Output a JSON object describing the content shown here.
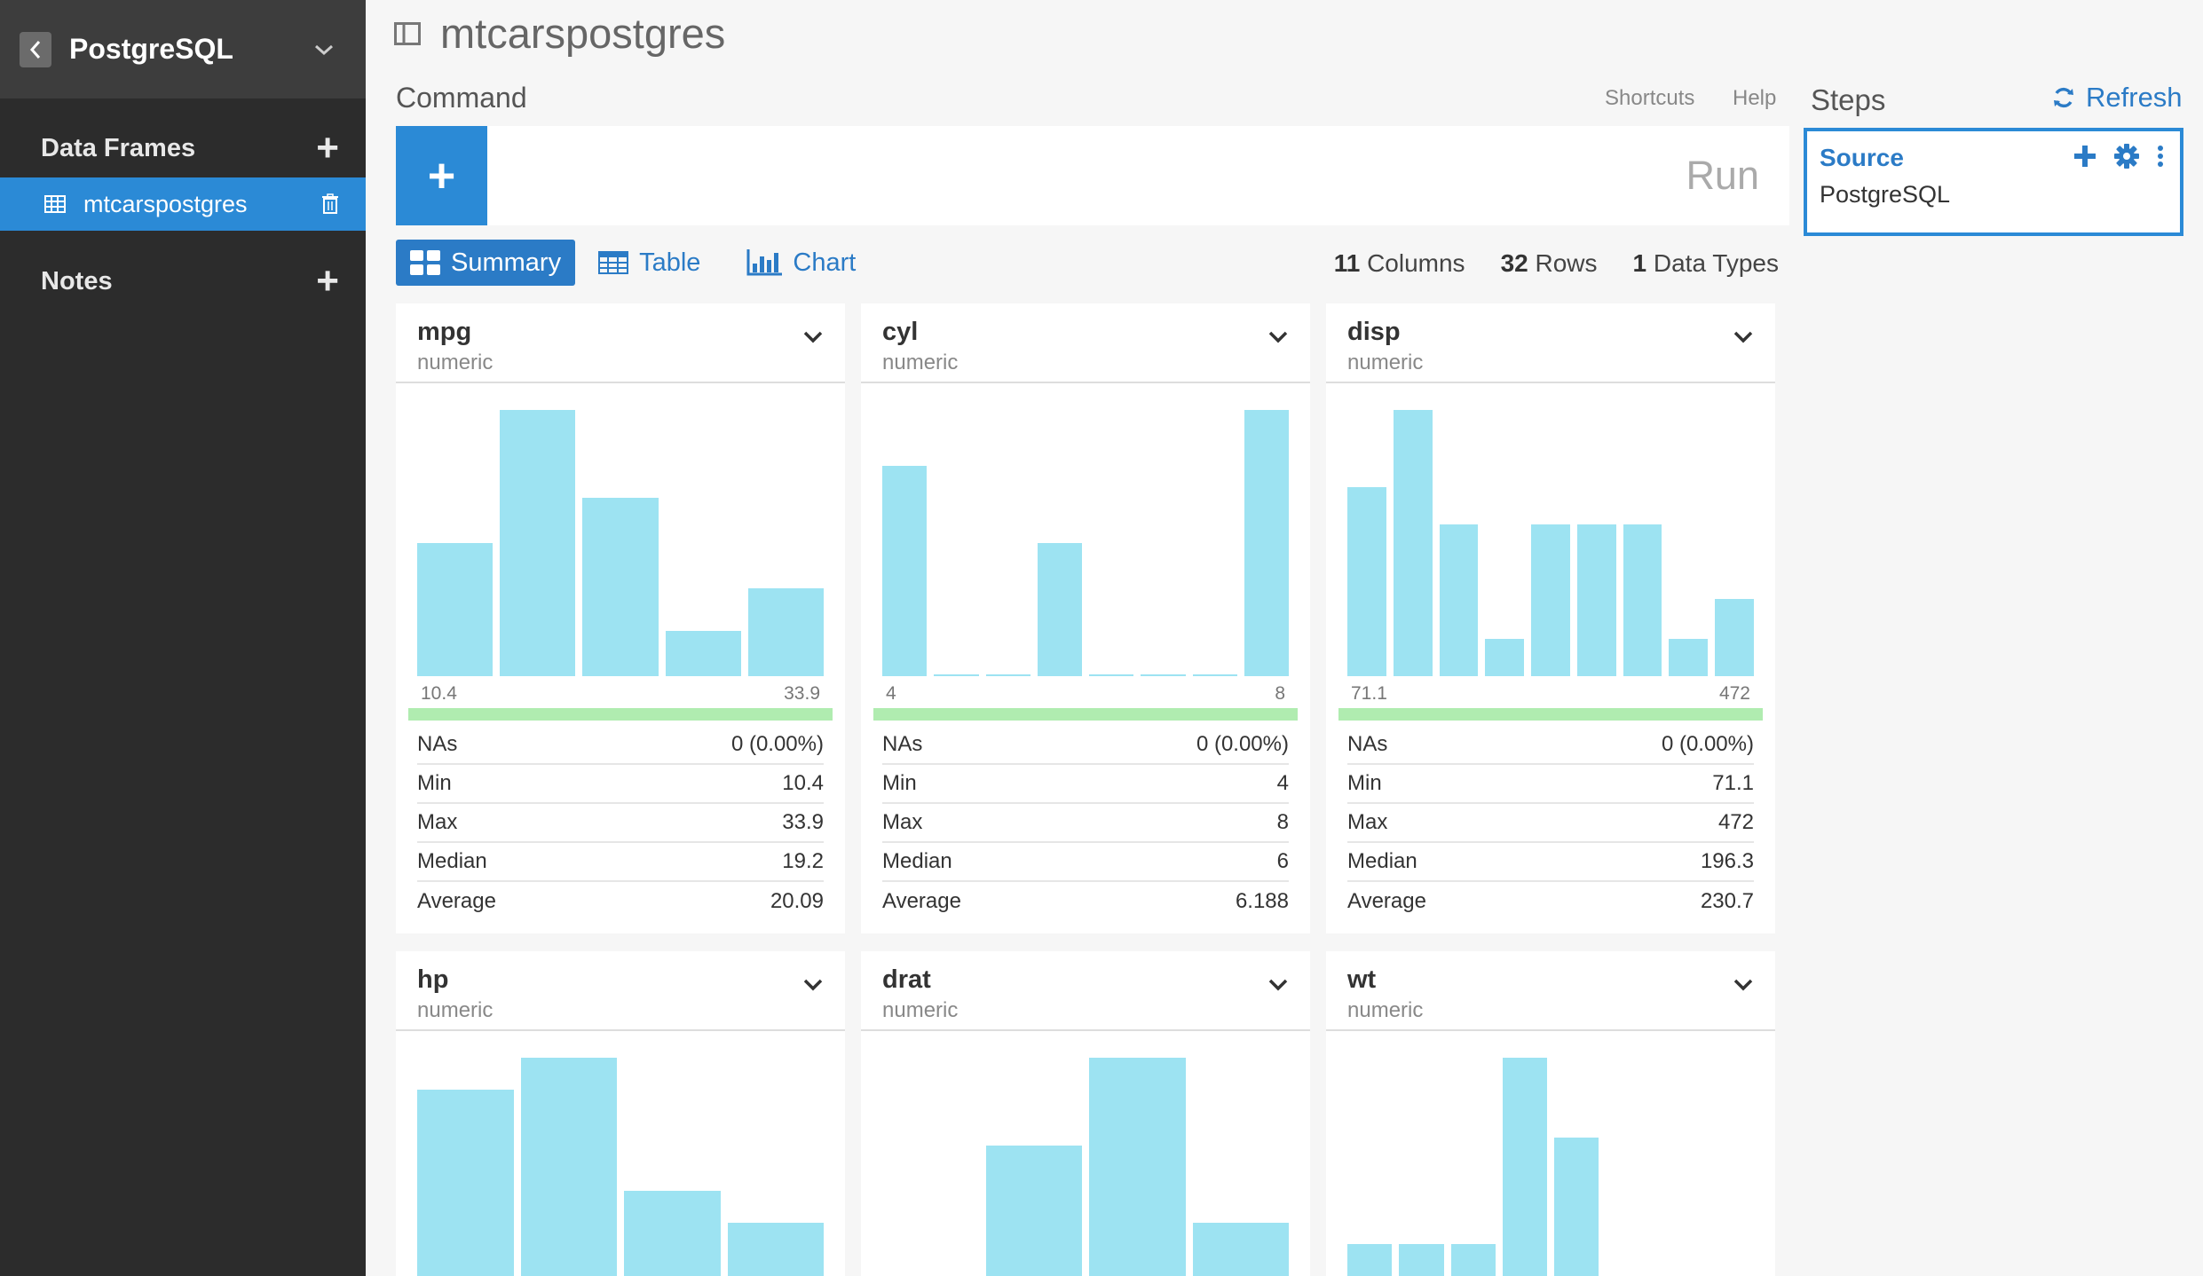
{
  "sidebar": {
    "title": "PostgreSQL",
    "sections": {
      "data_frames": "Data Frames",
      "notes": "Notes"
    },
    "active_frame": "mtcarspostgres"
  },
  "main": {
    "page_title": "mtcarspostgres",
    "command_label": "Command",
    "shortcuts": "Shortcuts",
    "help": "Help",
    "run": "Run",
    "add_symbol": "+",
    "tabs": [
      {
        "label": "Summary",
        "active": true
      },
      {
        "label": "Table",
        "active": false
      },
      {
        "label": "Chart",
        "active": false
      }
    ],
    "stats": {
      "columns_count": "11",
      "columns_label": "Columns",
      "rows_count": "32",
      "rows_label": "Rows",
      "types_count": "1",
      "types_label": "Data Types"
    }
  },
  "cards": [
    {
      "name": "mpg",
      "type": "numeric",
      "hist": [
        0.5,
        1.0,
        0.67,
        0.17,
        0.33
      ],
      "min_label": "10.4",
      "max_label": "33.9",
      "stats": [
        {
          "label": "NAs",
          "value": "0 (0.00%)"
        },
        {
          "label": "Min",
          "value": "10.4"
        },
        {
          "label": "Max",
          "value": "33.9"
        },
        {
          "label": "Median",
          "value": "19.2"
        },
        {
          "label": "Average",
          "value": "20.09"
        }
      ]
    },
    {
      "name": "cyl",
      "type": "numeric",
      "hist": [
        0.79,
        0.0,
        0.0,
        0.5,
        0.0,
        0.0,
        0.0,
        1.0
      ],
      "min_label": "4",
      "max_label": "8",
      "stats": [
        {
          "label": "NAs",
          "value": "0 (0.00%)"
        },
        {
          "label": "Min",
          "value": "4"
        },
        {
          "label": "Max",
          "value": "8"
        },
        {
          "label": "Median",
          "value": "6"
        },
        {
          "label": "Average",
          "value": "6.188"
        }
      ]
    },
    {
      "name": "disp",
      "type": "numeric",
      "hist": [
        0.71,
        1.0,
        0.57,
        0.14,
        0.57,
        0.57,
        0.57,
        0.14,
        0.29
      ],
      "min_label": "71.1",
      "max_label": "472",
      "stats": [
        {
          "label": "NAs",
          "value": "0 (0.00%)"
        },
        {
          "label": "Min",
          "value": "71.1"
        },
        {
          "label": "Max",
          "value": "472"
        },
        {
          "label": "Median",
          "value": "196.3"
        },
        {
          "label": "Average",
          "value": "230.7"
        }
      ]
    },
    {
      "name": "hp",
      "type": "numeric",
      "hist": [
        0.88,
        1.0,
        0.5,
        0.38
      ],
      "min_label": "",
      "max_label": "",
      "stats": []
    },
    {
      "name": "drat",
      "type": "numeric",
      "hist": [
        0.17,
        0.67,
        1.0,
        0.38
      ],
      "min_label": "",
      "max_label": "",
      "stats": []
    },
    {
      "name": "wt",
      "type": "numeric",
      "hist": [
        0.3,
        0.3,
        0.3,
        1.0,
        0.7,
        0.0,
        0.0,
        0.17
      ],
      "min_label": "",
      "max_label": "",
      "stats": []
    }
  ],
  "steps": {
    "label": "Steps",
    "refresh": "Refresh",
    "items": [
      {
        "title": "Source",
        "subtitle": "PostgreSQL"
      }
    ]
  }
}
